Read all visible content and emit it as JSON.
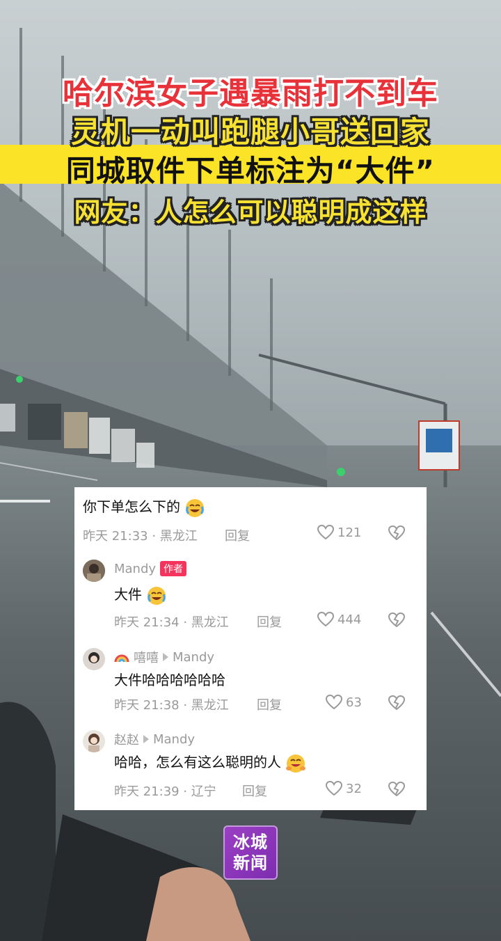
{
  "title": {
    "line1": "哈尔滨女子遇暴雨打不到车",
    "line2": "灵机一动叫跑腿小哥送回家",
    "line3": "同城取件下单标注为“大件”",
    "line4": "网友：人怎么可以聪明成这样"
  },
  "comments": [
    {
      "text": "你下单怎么下的",
      "emoji": "crying-laugh-emoji",
      "time": "昨天 21:33",
      "location": "黑龙江",
      "reply_label": "回复",
      "likes": "121"
    },
    {
      "user": "Mandy",
      "badge": "作者",
      "text": "大件",
      "emoji": "crying-laugh-emoji",
      "time": "昨天 21:34",
      "location": "黑龙江",
      "reply_label": "回复",
      "likes": "444"
    },
    {
      "user": "嘻嘻",
      "user_icon": "rainbow-emoji",
      "reply_to": "Mandy",
      "text": "大件哈哈哈哈哈哈",
      "time": "昨天 21:38",
      "location": "黑龙江",
      "reply_label": "回复",
      "likes": "63"
    },
    {
      "user": "赵赵",
      "reply_to": "Mandy",
      "text": "哈哈，怎么有这么聪明的人",
      "emoji": "grinning-hug-emoji",
      "time": "昨天 21:39",
      "location": "辽宁",
      "reply_label": "回复",
      "likes": "32"
    }
  ],
  "logo": {
    "line1": "冰城",
    "line2": "新闻"
  },
  "colors": {
    "title_red": "#e8323a",
    "title_yellow": "#f7e233",
    "band_yellow": "#fbe427",
    "author_badge": "#f4345c",
    "logo_purple": "#8b35b8"
  }
}
